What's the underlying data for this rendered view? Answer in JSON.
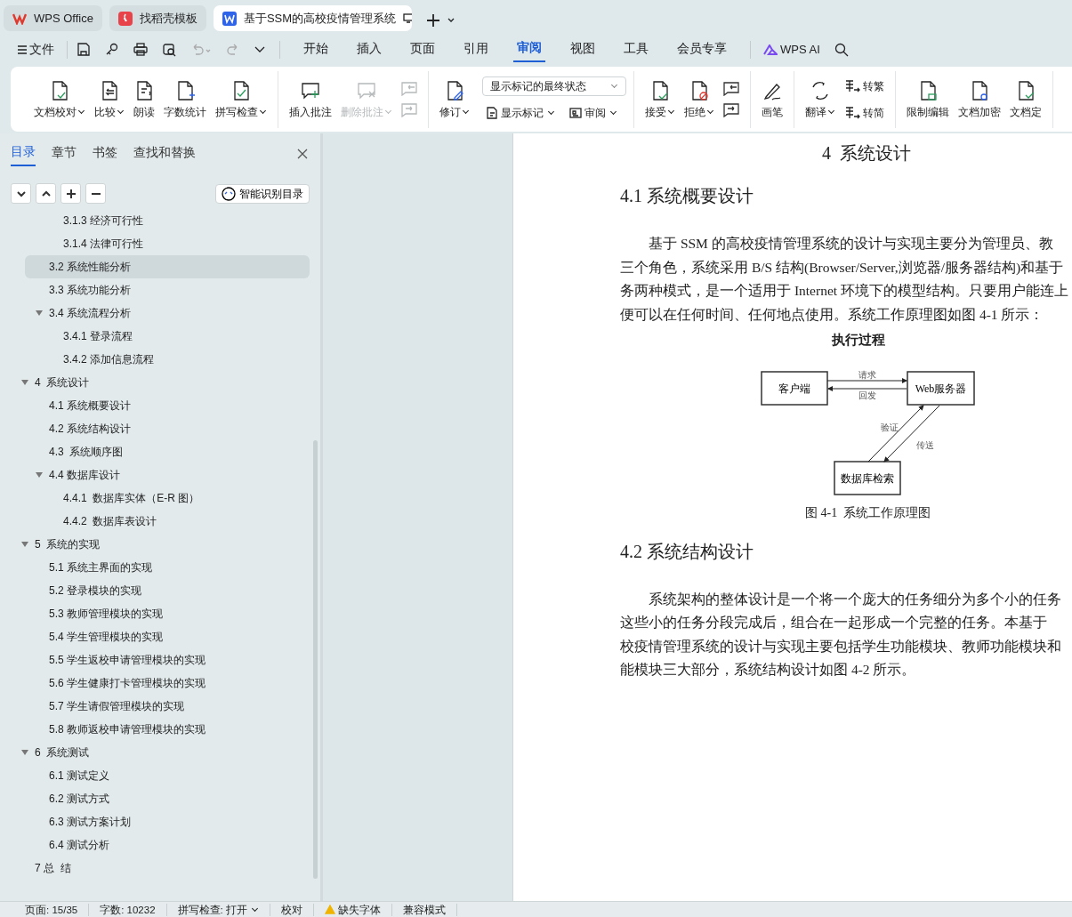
{
  "tabs": [
    {
      "kind": "home",
      "label": "WPS Office",
      "selected": false
    },
    {
      "kind": "template",
      "label": "找稻壳模板",
      "selected": false
    },
    {
      "kind": "document",
      "label": "基于SSM的高校疫情管理系统",
      "selected": true
    }
  ],
  "menu": {
    "file": "文件",
    "tabs": [
      {
        "label": "开始",
        "selected": false
      },
      {
        "label": "插入",
        "selected": false
      },
      {
        "label": "页面",
        "selected": false
      },
      {
        "label": "引用",
        "selected": false
      },
      {
        "label": "审阅",
        "selected": true
      },
      {
        "label": "视图",
        "selected": false
      },
      {
        "label": "工具",
        "selected": false
      },
      {
        "label": "会员专享",
        "selected": false
      }
    ],
    "ai": "WPS AI"
  },
  "ribbon": [
    {
      "items": [
        {
          "kind": "large",
          "label": "文档校对",
          "menu": true,
          "disabled": false
        },
        {
          "kind": "large",
          "label": "比较",
          "menu": true,
          "disabled": false
        },
        {
          "kind": "large",
          "label": "朗读",
          "menu": false,
          "disabled": false
        },
        {
          "kind": "large",
          "label": "字数统计",
          "menu": false,
          "disabled": false
        },
        {
          "kind": "large",
          "label": "拼写检查",
          "menu": true,
          "disabled": false
        }
      ]
    },
    {
      "items": [
        {
          "kind": "large",
          "label": "插入批注",
          "menu": false,
          "disabled": false
        },
        {
          "kind": "large",
          "label": "删除批注",
          "menu": true,
          "disabled": true
        },
        {
          "kind": "pair",
          "disabled": true
        }
      ]
    },
    {
      "items": [
        {
          "kind": "large",
          "label": "修订",
          "menu": true,
          "disabled": false
        },
        {
          "kind": "markup",
          "value": "显示标记的最终状态",
          "small": [
            {
              "label": "显示标记",
              "menu": true
            },
            {
              "label": "审阅",
              "menu": true
            }
          ]
        }
      ]
    },
    {
      "items": [
        {
          "kind": "large",
          "label": "接受",
          "menu": true,
          "disabled": false
        },
        {
          "kind": "large",
          "label": "拒绝",
          "menu": true,
          "disabled": false
        },
        {
          "kind": "pair",
          "disabled": false
        }
      ]
    },
    {
      "items": [
        {
          "kind": "large",
          "label": "画笔",
          "menu": false,
          "disabled": false
        }
      ]
    },
    {
      "items": [
        {
          "kind": "large",
          "label": "翻译",
          "menu": true,
          "disabled": false
        },
        {
          "kind": "stack",
          "small": [
            {
              "label": "转繁",
              "menu": false
            },
            {
              "label": "转简",
              "menu": false
            }
          ]
        }
      ]
    },
    {
      "items": [
        {
          "kind": "large",
          "label": "限制编辑",
          "menu": false,
          "disabled": false
        },
        {
          "kind": "large",
          "label": "文档加密",
          "menu": false,
          "disabled": false
        },
        {
          "kind": "large",
          "label": "文档定",
          "menu": false,
          "disabled": false
        }
      ]
    }
  ],
  "sidebar": {
    "tabs": [
      {
        "label": "目录",
        "selected": true
      },
      {
        "label": "章节",
        "selected": false
      },
      {
        "label": "书签",
        "selected": false
      },
      {
        "label": "查找和替换",
        "selected": false
      }
    ],
    "smart_button": "智能识别目录",
    "toc": [
      {
        "children": [
          {
            "children": [
              {
                "label": "3.1.3 经济可行性",
                "selected": false
              },
              {
                "label": "3.1.4 法律可行性",
                "selected": false
              }
            ]
          },
          {
            "label": "3.2 系统性能分析",
            "selected": true
          },
          {
            "label": "3.3 系统功能分析",
            "selected": false
          },
          {
            "label": "3.4 系统流程分析",
            "selected": false,
            "expanded": true,
            "children": [
              {
                "label": "3.4.1 登录流程",
                "selected": false
              },
              {
                "label": "3.4.2 添加信息流程",
                "selected": false
              }
            ]
          }
        ]
      },
      {
        "label": "4  系统设计",
        "selected": false,
        "expanded": true,
        "children": [
          {
            "label": "4.1 系统概要设计",
            "selected": false
          },
          {
            "label": "4.2 系统结构设计",
            "selected": false
          },
          {
            "label": "4.3  系统顺序图",
            "selected": false
          },
          {
            "label": "4.4 数据库设计",
            "selected": false,
            "expanded": true,
            "children": [
              {
                "label": "4.4.1  数据库实体（E-R 图）",
                "selected": false
              },
              {
                "label": "4.4.2  数据库表设计",
                "selected": false
              }
            ]
          }
        ]
      },
      {
        "label": "5  系统的实现",
        "selected": false,
        "expanded": true,
        "children": [
          {
            "label": "5.1 系统主界面的实现",
            "selected": false
          },
          {
            "label": "5.2 登录模块的实现",
            "selected": false
          },
          {
            "label": "5.3 教师管理模块的实现",
            "selected": false
          },
          {
            "label": "5.4 学生管理模块的实现",
            "selected": false
          },
          {
            "label": "5.5 学生返校申请管理模块的实现",
            "selected": false
          },
          {
            "label": "5.6 学生健康打卡管理模块的实现",
            "selected": false
          },
          {
            "label": "5.7 学生请假管理模块的实现",
            "selected": false
          },
          {
            "label": "5.8 教师返校申请管理模块的实现",
            "selected": false
          }
        ]
      },
      {
        "label": "6  系统测试",
        "selected": false,
        "expanded": true,
        "children": [
          {
            "label": "6.1 测试定义",
            "selected": false
          },
          {
            "label": "6.2 测试方式",
            "selected": false
          },
          {
            "label": "6.3 测试方案计划",
            "selected": false
          },
          {
            "label": "6.4 测试分析",
            "selected": false
          }
        ]
      },
      {
        "label": "7 总  结",
        "selected": false
      }
    ]
  },
  "document": {
    "chapter": "4  系统设计",
    "sections": [
      {
        "heading": "4.1 系统概要设计",
        "lines": [
          "基于 SSM 的高校疫情管理系统的设计与实现主要分为管理员、教",
          "三个角色，系统采用 B/S 结构(Browser/Server,浏览器/服务器结构)和基于",
          "务两种模式，是一个适用于 Internet 环境下的模型结构。只要用户能连上",
          "便可以在任何时间、任何地点使用。系统工作原理图如图 4-1 所示："
        ],
        "figure": {
          "title": "执行过程",
          "nodes": [
            "客户端",
            "Web服务器",
            "数据库检索"
          ],
          "edges": [
            "请求",
            "回发",
            "验证",
            "传送"
          ],
          "caption": "图 4-1  系统工作原理图"
        }
      },
      {
        "heading": "4.2 系统结构设计",
        "lines": [
          "系统架构的整体设计是一个将一个庞大的任务细分为多个小的任务",
          "这些小的任务分段完成后，组合在一起形成一个完整的任务。本基于",
          "校疫情管理系统的设计与实现主要包括学生功能模块、教师功能模块和",
          "能模块三大部分，系统结构设计如图 4-2 所示。"
        ]
      }
    ]
  },
  "status_bar": [
    {
      "kind": "text",
      "text": "页面: 15/35",
      "menu": false
    },
    {
      "kind": "text",
      "text": "字数: 10232",
      "menu": false
    },
    {
      "kind": "text",
      "text": "拼写检查: 打开",
      "menu": true
    },
    {
      "kind": "text",
      "text": "校对",
      "menu": false
    },
    {
      "kind": "warning",
      "text": "缺失字体",
      "menu": false
    },
    {
      "kind": "text",
      "text": "兼容模式",
      "menu": false
    }
  ]
}
